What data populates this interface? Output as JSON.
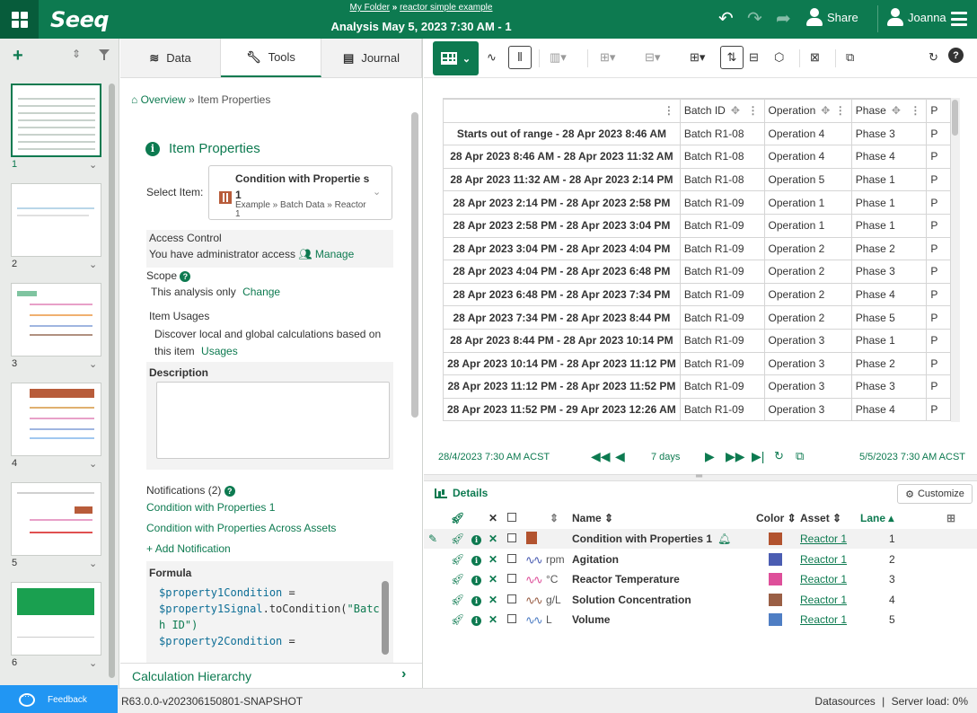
{
  "header": {
    "app_logo": "Seeq",
    "folder_link": "My Folder",
    "breadcrumb_separator": "»",
    "workbook_link": "reactor simple example",
    "analysis_title": "Analysis May 5, 2023 7:30 AM - 1",
    "share_label": "Share",
    "user_name": "Joanna",
    "brand_color": "#0d7a50"
  },
  "worksheets": {
    "items": [
      {
        "number": "1",
        "active": true
      },
      {
        "number": "2",
        "active": false
      },
      {
        "number": "3",
        "active": false
      },
      {
        "number": "4",
        "active": false
      },
      {
        "number": "5",
        "active": false
      },
      {
        "number": "6",
        "active": false
      }
    ]
  },
  "tabs": [
    {
      "label": "Data",
      "icon": "database-icon"
    },
    {
      "label": "Tools",
      "icon": "wrench-icon"
    },
    {
      "label": "Journal",
      "icon": "book-icon"
    }
  ],
  "tools": {
    "breadcrumb_overview": "Overview",
    "breadcrumb_sep": "»",
    "breadcrumb_current": "Item Properties",
    "title": "Item Properties",
    "select_item_label": "Select Item:",
    "selected_item_name": "Condition with Propertie s 1",
    "selected_item_path": "Example » Batch Data » Reactor 1",
    "access_control_label": "Access Control",
    "access_text": "You have administrator access",
    "manage_label": "Manage",
    "scope_label": "Scope",
    "scope_value": "This analysis only",
    "scope_change": "Change",
    "usages_label": "Item Usages",
    "usages_text": "Discover local and global calculations based on this item",
    "usages_link": "Usages",
    "description_label": "Description",
    "description_value": "",
    "notifications_label": "Notifications (2)",
    "notifications": [
      "Condition with Properties 1",
      "Condition with Properties Across Assets"
    ],
    "add_notification": "Add Notification",
    "formula_label": "Formula",
    "formula_lines": [
      {
        "var": "$property1Condition",
        "rest": " ="
      },
      {
        "var": "$property1Signal",
        "rest": ".toCondition(",
        "str": "\"Batc"
      },
      {
        "var": "",
        "rest": "",
        "str": "h ID\")"
      },
      {
        "var": "$property2Condition",
        "rest": " ="
      }
    ],
    "calc_hierarchy": "Calculation Hierarchy"
  },
  "table": {
    "columns": [
      "",
      "Batch ID",
      "Operation",
      "Phase",
      "P"
    ],
    "rows": [
      [
        "Starts out of range - 28 Apr 2023 8:46 AM",
        "Batch R1-08",
        "Operation 4",
        "Phase 3",
        "P"
      ],
      [
        "28 Apr 2023 8:46 AM - 28 Apr 2023 11:32 AM",
        "Batch R1-08",
        "Operation 4",
        "Phase 4",
        "P"
      ],
      [
        "28 Apr 2023 11:32 AM - 28 Apr 2023 2:14 PM",
        "Batch R1-08",
        "Operation 5",
        "Phase 1",
        "P"
      ],
      [
        "28 Apr 2023 2:14 PM - 28 Apr 2023 2:58 PM",
        "Batch R1-09",
        "Operation 1",
        "Phase 1",
        "P"
      ],
      [
        "28 Apr 2023 2:58 PM - 28 Apr 2023 3:04 PM",
        "Batch R1-09",
        "Operation 1",
        "Phase 1",
        "P"
      ],
      [
        "28 Apr 2023 3:04 PM - 28 Apr 2023 4:04 PM",
        "Batch R1-09",
        "Operation 2",
        "Phase 2",
        "P"
      ],
      [
        "28 Apr 2023 4:04 PM - 28 Apr 2023 6:48 PM",
        "Batch R1-09",
        "Operation 2",
        "Phase 3",
        "P"
      ],
      [
        "28 Apr 2023 6:48 PM - 28 Apr 2023 7:34 PM",
        "Batch R1-09",
        "Operation 2",
        "Phase 4",
        "P"
      ],
      [
        "28 Apr 2023 7:34 PM - 28 Apr 2023 8:44 PM",
        "Batch R1-09",
        "Operation 2",
        "Phase 5",
        "P"
      ],
      [
        "28 Apr 2023 8:44 PM - 28 Apr 2023 10:14 PM",
        "Batch R1-09",
        "Operation 3",
        "Phase 1",
        "P"
      ],
      [
        "28 Apr 2023 10:14 PM - 28 Apr 2023 11:12 PM",
        "Batch R1-09",
        "Operation 3",
        "Phase 2",
        "P"
      ],
      [
        "28 Apr 2023 11:12 PM - 28 Apr 2023 11:52 PM",
        "Batch R1-09",
        "Operation 3",
        "Phase 3",
        "P"
      ],
      [
        "28 Apr 2023 11:52 PM - 29 Apr 2023 12:26 AM",
        "Batch R1-09",
        "Operation 3",
        "Phase 4",
        "P"
      ]
    ]
  },
  "range": {
    "start": "28/4/2023 7:30 AM  ACST",
    "duration": "7 days",
    "end": "5/5/2023 7:30 AM  ACST"
  },
  "details": {
    "title": "Details",
    "customize_label": "Customize",
    "headers": {
      "name": "Name",
      "color": "Color",
      "asset": "Asset",
      "lane": "Lane"
    },
    "rows": [
      {
        "unit": "",
        "name": "Condition with Properties 1",
        "color": "#b2532f",
        "asset": "Reactor 1",
        "lane": "1",
        "type": "condition"
      },
      {
        "unit": "rpm",
        "name": "Agitation",
        "color": "#4b5db2",
        "asset": "Reactor 1",
        "lane": "2",
        "type": "signal"
      },
      {
        "unit": "°C",
        "name": "Reactor Temperature",
        "color": "#de4f9a",
        "asset": "Reactor 1",
        "lane": "3",
        "type": "signal"
      },
      {
        "unit": "g/L",
        "name": "Solution Concentration",
        "color": "#9a5f45",
        "asset": "Reactor 1",
        "lane": "4",
        "type": "signal"
      },
      {
        "unit": "L",
        "name": "Volume",
        "color": "#4f7ec4",
        "asset": "Reactor 1",
        "lane": "5",
        "type": "signal"
      }
    ]
  },
  "footer": {
    "feedback_label": "Feedback",
    "version": "R63.0.0-v202306150801-SNAPSHOT",
    "datasources": "Datasources",
    "separator": "|",
    "server_load": "Server load:  0%"
  }
}
